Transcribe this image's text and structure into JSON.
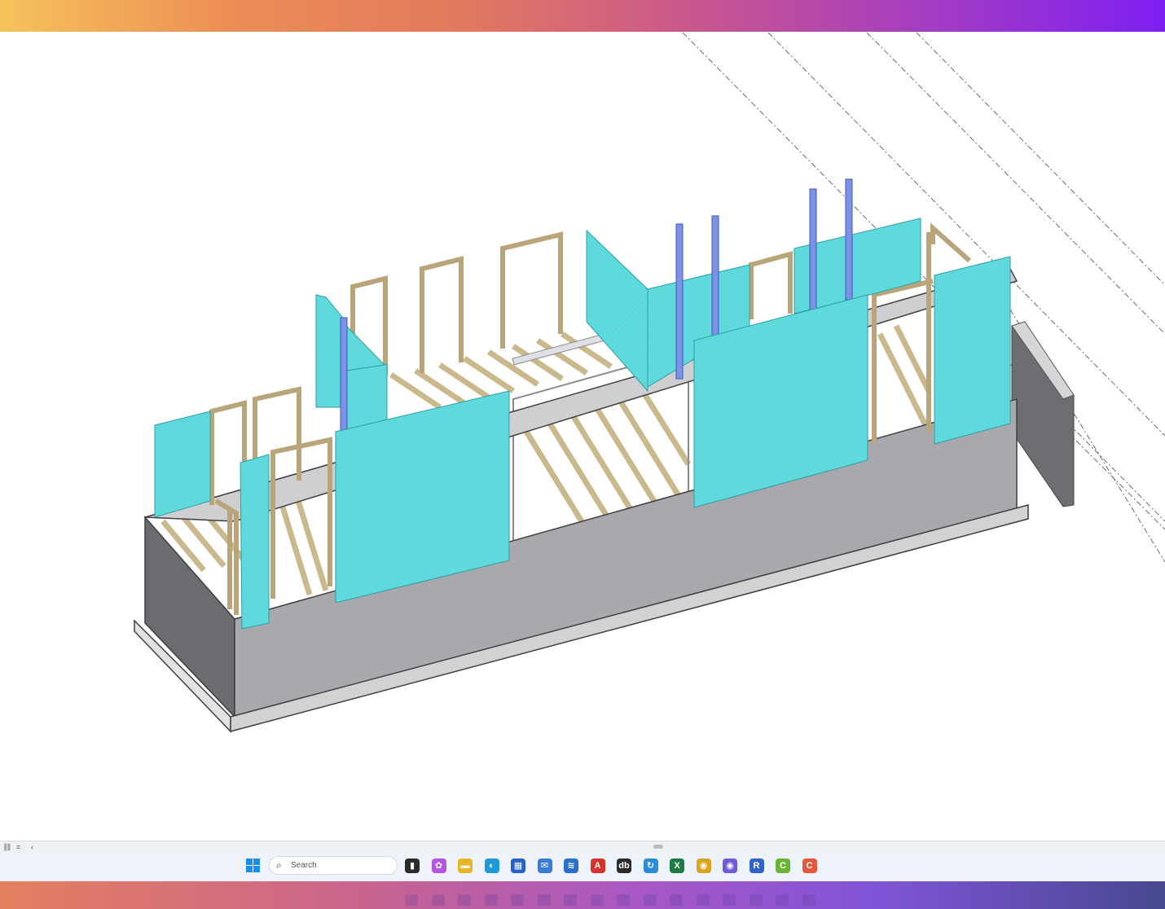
{
  "taskbar": {
    "search_placeholder": "Search",
    "apps": [
      {
        "name": "task-view",
        "glyph": "▮",
        "color": "#2b2b2b"
      },
      {
        "name": "copilot",
        "glyph": "✿",
        "color": "#b457e0"
      },
      {
        "name": "file-explorer",
        "glyph": "▬",
        "color": "#e7b526"
      },
      {
        "name": "edge",
        "glyph": "◐",
        "color": "#1e9bd7"
      },
      {
        "name": "microsoft-store",
        "glyph": "▦",
        "color": "#2461c9"
      },
      {
        "name": "mail",
        "glyph": "✉",
        "color": "#3a7bd5"
      },
      {
        "name": "stacked-app",
        "glyph": "≋",
        "color": "#2a6fc9"
      },
      {
        "name": "autocad",
        "glyph": "A",
        "color": "#d7322b"
      },
      {
        "name": "db-app",
        "glyph": "db",
        "color": "#2a2a2a"
      },
      {
        "name": "sync-app",
        "glyph": "↻",
        "color": "#2d8bd7"
      },
      {
        "name": "excel",
        "glyph": "X",
        "color": "#1f7a44"
      },
      {
        "name": "chrome",
        "glyph": "◉",
        "color": "#d9a521"
      },
      {
        "name": "chrome-profile",
        "glyph": "◉",
        "color": "#6f5bd6"
      },
      {
        "name": "revit",
        "glyph": "R",
        "color": "#2f63c6"
      },
      {
        "name": "cad-green",
        "glyph": "C",
        "color": "#6ab336"
      },
      {
        "name": "cad-orange",
        "glyph": "C",
        "color": "#e4583c"
      }
    ]
  },
  "statusbar": {
    "icons": [
      "link-icon",
      "crop-icon",
      "chevron-left-icon"
    ]
  },
  "colors": {
    "sheathing": "#5fd9dc",
    "stud": "#d6c8a0",
    "steel_column": "#7c92e6",
    "foundation": "#a9a9ad"
  }
}
